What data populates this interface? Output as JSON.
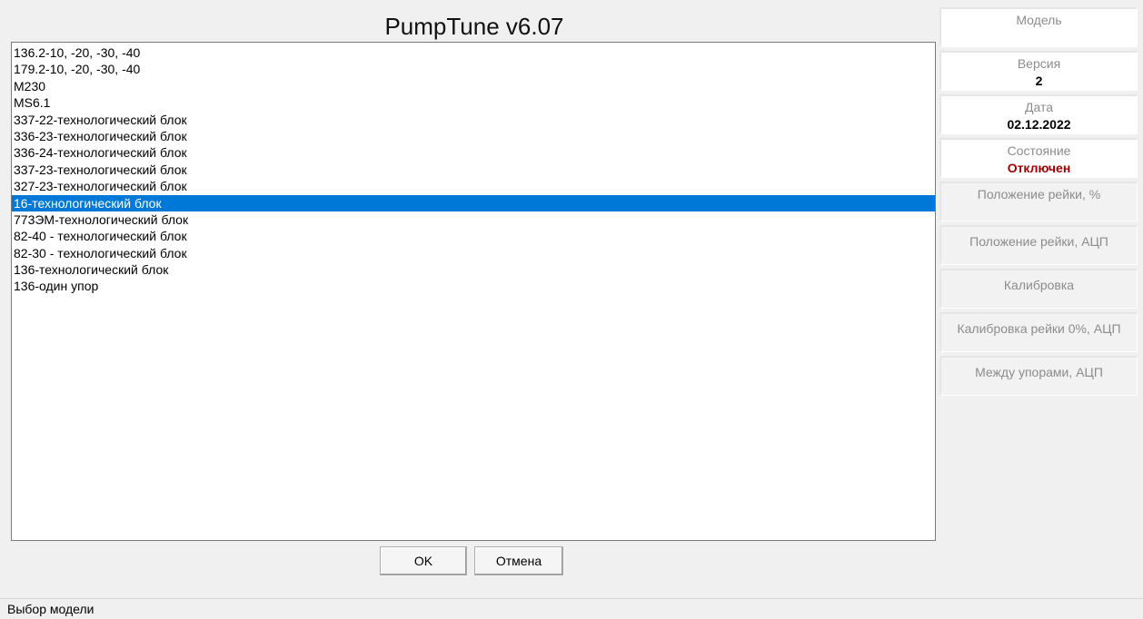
{
  "window": {
    "title": "PumpTune v6.07"
  },
  "model_list": {
    "selected_index": 9,
    "items": [
      "136.2-10, -20, -30, -40",
      "179.2-10, -20, -30, -40",
      "M230",
      "MS6.1",
      "337-22-технологический блок",
      "336-23-технологический блок",
      "336-24-технологический блок",
      "337-23-технологический блок",
      "327-23-технологический блок",
      "16-технологический блок",
      "773ЭМ-технологический блок",
      "82-40 - технологический блок",
      "82-30 - технологический блок",
      "136-технологический блок",
      "136-один упор"
    ]
  },
  "buttons": {
    "ok_label": "OK",
    "cancel_label": "Отмена"
  },
  "info_panels": {
    "model": {
      "label": "Модель",
      "value": ""
    },
    "version": {
      "label": "Версия",
      "value": "2"
    },
    "date": {
      "label": "Дата",
      "value": "02.12.2022"
    },
    "state": {
      "label": "Состояние",
      "value": "Отключен"
    },
    "rack_position_percent": {
      "label": "Положение рейки, %",
      "value": ""
    },
    "rack_position_adc": {
      "label": "Положение рейки, АЦП",
      "value": ""
    },
    "calibration": {
      "label": "Калибровка",
      "value": ""
    },
    "rack_calibration_zero_adc": {
      "label": "Калибровка рейки 0%, АЦП",
      "value": ""
    },
    "between_stops_adc": {
      "label": "Между упорами, АЦП",
      "value": ""
    }
  },
  "statusbar": {
    "text": "Выбор модели"
  },
  "colors": {
    "selection": "#0078d7",
    "state_alert": "#a00000",
    "label_gray": "#8c8c8c"
  }
}
